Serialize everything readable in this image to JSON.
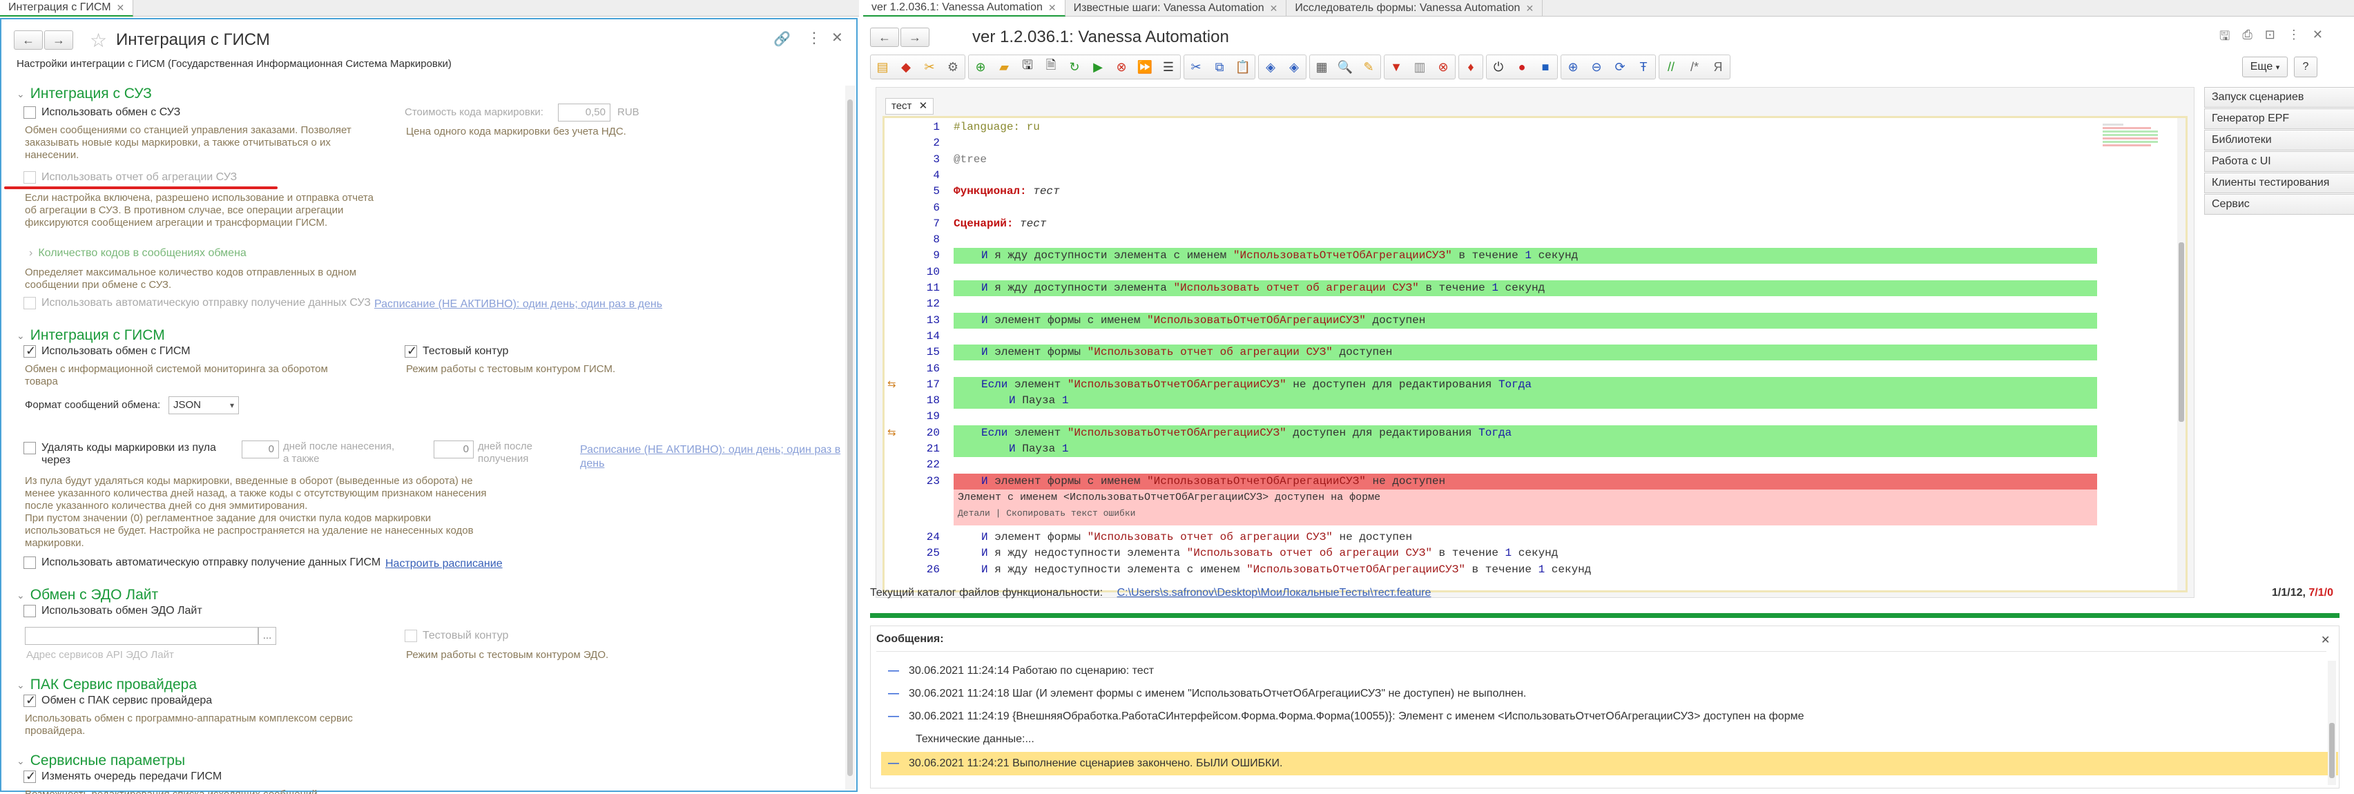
{
  "left_tab": {
    "label": "Интеграция с ГИСМ"
  },
  "right_tabs": [
    {
      "label": "ver 1.2.036.1: Vanessa Automation"
    },
    {
      "label": "Известные шаги: Vanessa Automation"
    },
    {
      "label": "Исследователь формы: Vanessa Automation"
    }
  ],
  "form": {
    "title": "Интеграция с ГИСМ",
    "subtitle": "Настройки интеграции с ГИСМ (Государственная Информационная Система Маркировки)",
    "suz": {
      "heading": "Интеграция с СУЗ",
      "use_exchange": "Использовать обмен с СУЗ",
      "use_exchange_note": "Обмен сообщениями со станцией управления заказами. Позволяет заказывать новые коды маркировки, а также отчитываться о их нанесении.",
      "cost_label": "Стоимость кода маркировки:",
      "cost_value": "0,50",
      "cost_unit": "RUB",
      "cost_note": "Цена одного кода маркировки без учета НДС.",
      "aggregation": "Использовать отчет об агрегации СУЗ",
      "aggregation_note": "Если настройка включена, разрешено использование и отправка отчета об агрегации в СУЗ. В противном случае, все операции агрегации фиксируются сообщением агрегации и трансформации ГИСМ.",
      "codes_count": "Количество кодов в сообщениях обмена",
      "codes_count_note": "Определяет максимальное количество кодов отправленных в одном сообщении при обмене с СУЗ.",
      "auto_send": "Использовать автоматическую отправку получение данных СУЗ",
      "schedule_link": "Расписание (НЕ АКТИВНО): один день; один раз в день"
    },
    "gism": {
      "heading": "Интеграция с ГИСМ",
      "use_exchange": "Использовать обмен с ГИСМ",
      "use_exchange_note": "Обмен с информационной системой мониторинга за оборотом товара",
      "test_contour": "Тестовый контур",
      "test_contour_note": "Режим работы с тестовым контуром ГИСМ.",
      "format_label": "Формат сообщений обмена:",
      "format_value": "JSON",
      "delete_codes": "Удалять коды маркировки из пула через",
      "days_after_apply_value": "0",
      "days_after_apply": "дней после нанесения, а также",
      "days_after_receive_value": "0",
      "days_after_receive": "дней после получения",
      "schedule_link": "Расписание (НЕ АКТИВНО): один день; один раз в день",
      "delete_note": "Из пула будут удаляться коды маркировки, введенные в оборот (выведенные из оборота) не менее указанного количества дней назад, а также коды с отсутствующим признаком нанесения после указанного количества дней со дня эммитирования.\nПри пустом значении (0) регламентное задание для очистки пула кодов маркировки использоваться не будет. Настройка не распространяется на удаление не нанесенных кодов маркировки.",
      "auto_send": "Использовать автоматическую отправку получение данных ГИСМ",
      "configure_schedule": "Настроить расписание"
    },
    "edo": {
      "heading": "Обмен с ЭДО Лайт",
      "use_exchange": "Использовать обмен ЭДО Лайт",
      "address_placeholder": "Адрес сервисов API ЭДО Лайт",
      "test_contour": "Тестовый контур",
      "test_contour_note": "Режим работы с тестовым контуром ЭДО."
    },
    "pak": {
      "heading": "ПАК Сервис провайдера",
      "exchange": "Обмен с ПАК сервис провайдера",
      "note": "Использовать обмен с программно-аппаратным комплексом сервис провайдера."
    },
    "service": {
      "heading": "Сервисные параметры",
      "change_queue": "Изменять очередь передачи ГИСМ",
      "note": "Возможность редактирования списка исходящих сообщений"
    }
  },
  "va": {
    "title": "ver 1.2.036.1: Vanessa Automation",
    "more_label": "Еще",
    "help_label": "?",
    "editor_tab": "тест",
    "lines": [
      {
        "n": "1",
        "text": "#language: ru"
      },
      {
        "n": "2",
        "text": ""
      },
      {
        "n": "3",
        "text": "@tree"
      },
      {
        "n": "4",
        "text": ""
      },
      {
        "n": "5",
        "kw": "Функционал:",
        "rest": " тест"
      },
      {
        "n": "6",
        "text": ""
      },
      {
        "n": "7",
        "kw": "Сценарий:",
        "rest": " тест"
      },
      {
        "n": "8",
        "text": ""
      },
      {
        "n": "9",
        "kw": "И",
        "a": " я жду доступности элемента с именем ",
        "s": "\"ИспользоватьОтчетОбАгрегацииСУЗ\"",
        "b": " в течение ",
        "num": "1",
        "c": " секунд"
      },
      {
        "n": "10",
        "text": ""
      },
      {
        "n": "11",
        "kw": "И",
        "a": " я жду доступности элемента ",
        "s": "\"Использовать отчет об агрегации СУЗ\"",
        "b": " в течение ",
        "num": "1",
        "c": " секунд"
      },
      {
        "n": "12",
        "text": ""
      },
      {
        "n": "13",
        "kw": "И",
        "a": " элемент формы с именем ",
        "s": "\"ИспользоватьОтчетОбАгрегацииСУЗ\"",
        "b": " доступен"
      },
      {
        "n": "14",
        "text": ""
      },
      {
        "n": "15",
        "kw": "И",
        "a": " элемент формы ",
        "s": "\"Использовать отчет об агрегации СУЗ\"",
        "b": " доступен"
      },
      {
        "n": "16",
        "text": ""
      },
      {
        "n": "17",
        "kw": "Если",
        "a": " элемент ",
        "s": "\"ИспользоватьОтчетОбАгрегацииСУЗ\"",
        "b": " не доступен для редактирования ",
        "num": "Тогда"
      },
      {
        "n": "18",
        "kw": "И",
        "a": " Пауза ",
        "num": "1"
      },
      {
        "n": "19",
        "text": ""
      },
      {
        "n": "20",
        "kw": "Если",
        "a": " элемент ",
        "s": "\"ИспользоватьОтчетОбАгрегацииСУЗ\"",
        "b": " доступен для редактирования ",
        "num": "Тогда"
      },
      {
        "n": "21",
        "kw": "И",
        "a": " Пауза ",
        "num": "1"
      },
      {
        "n": "22",
        "text": ""
      },
      {
        "n": "23",
        "kw": "И",
        "a": " элемент формы с именем ",
        "s": "\"ИспользоватьОтчетОбАгрегацииСУЗ\"",
        "b": " не доступен"
      },
      {
        "n": "24",
        "kw": "И",
        "a": " элемент формы ",
        "s": "\"Использовать отчет об агрегации СУЗ\"",
        "b": " не доступен"
      },
      {
        "n": "25",
        "kw": "И",
        "a": " я жду недоступности элемента ",
        "s": "\"Использовать отчет об агрегации СУЗ\"",
        "b": " в течение ",
        "num": "1",
        "c": " секунд"
      },
      {
        "n": "26",
        "kw": "И",
        "a": " я жду недоступности элемента с именем ",
        "s": "\"ИспользоватьОтчетОбАгрегацииСУЗ\"",
        "b": " в течение ",
        "num": "1",
        "c": " секунд"
      }
    ],
    "error_text": "Элемент с именем <ИспользоватьОтчетОбАгрегацииСУЗ> доступен на форме",
    "error_actions": "Детали | Скопировать текст ошибки",
    "side_buttons": [
      "Запуск сценариев",
      "Генератор EPF",
      "Библиотеки",
      "Работа с UI",
      "Клиенты тестирования",
      "Сервис"
    ],
    "catalog_label": "Текущий каталог файлов функциональности:",
    "catalog_path": "C:\\Users\\s.safronov\\Desktop\\МоиЛокальныеТесты\\тест.feature",
    "counter_a": "1/1/12, ",
    "counter_b": "7/1/0",
    "messages_title": "Сообщения:",
    "messages": [
      "30.06.2021 11:24:14 Работаю по сценарию: тест",
      "30.06.2021 11:24:18 Шаг (И элемент формы с именем \"ИспользоватьОтчетОбАгрегацииСУЗ\" не доступен) не выполнен.",
      "30.06.2021 11:24:19 {ВнешняяОбработка.РаботаСИнтерфейсом.Форма.Форма.Форма(10055)}: Элемент с именем <ИспользоватьОтчетОбАгрегацииСУЗ> доступен на форме",
      "Технические данные:...",
      "30.06.2021 11:24:21 Выполнение сценариев закончено. БЫЛИ ОШИБКИ."
    ],
    "colors": {
      "green": "#90ee90",
      "red": "#ef7070",
      "pink": "#ffc8c8",
      "yellow": "#ffe38a"
    }
  }
}
